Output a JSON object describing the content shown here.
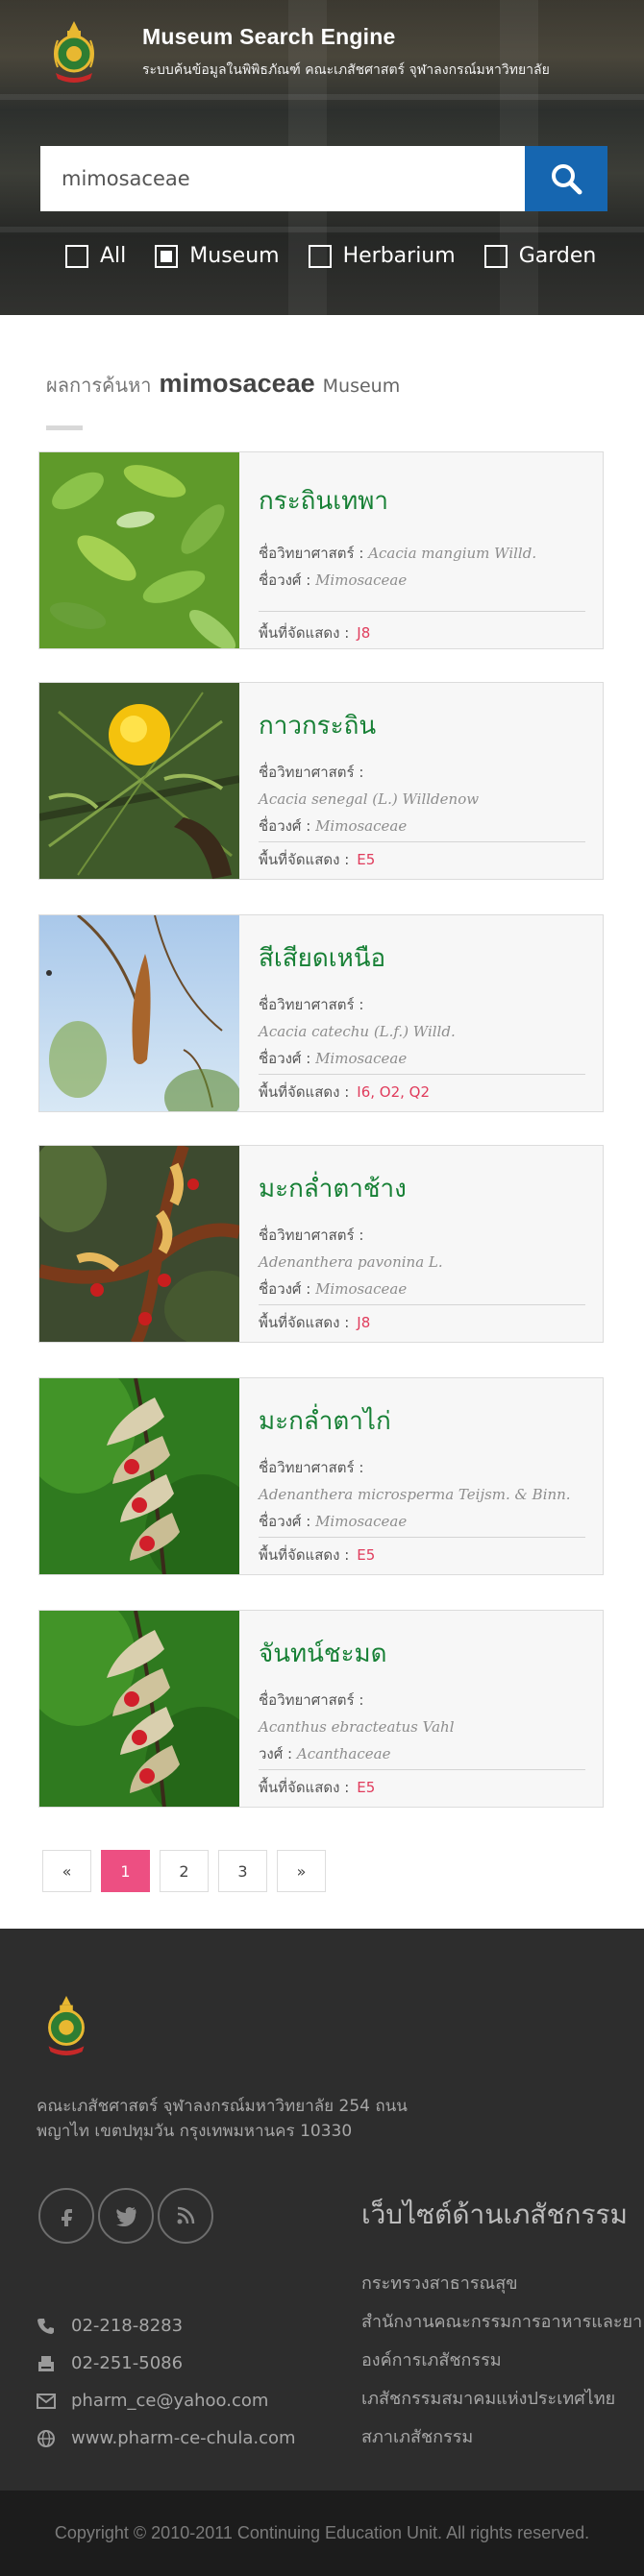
{
  "header": {
    "title": "Museum Search Engine",
    "subtitle": "ระบบค้นข้อมูลในพิพิธภัณฑ์ คณะเภสัชศาสตร์ จุฬาลงกรณ์มหาวิทยาลัย"
  },
  "search": {
    "value": "mimosaceae",
    "placeholder": ""
  },
  "filters": [
    {
      "label": "All",
      "checked": false
    },
    {
      "label": "Museum",
      "checked": true
    },
    {
      "label": "Herbarium",
      "checked": false
    },
    {
      "label": "Garden",
      "checked": false
    }
  ],
  "results": {
    "prefix": "ผลการค้นหา",
    "keyword": "mimosaceae",
    "scope": "Museum"
  },
  "labels": {
    "sci_name": "ชื่อวิทยาศาสตร์",
    "family": "ชื่อวงศ์",
    "family_short": "วงศ์",
    "location": "พื้นที่จัดแสดง :"
  },
  "cards": [
    {
      "name": "กระถินเทพา",
      "sci": "Acacia mangium Willd.",
      "family": "Mimosaceae",
      "loc": "J8",
      "inline_sci": true
    },
    {
      "name": "กาวกระถิน",
      "sci": "Acacia senegal (L.) Willdenow",
      "family": "Mimosaceae",
      "loc": "E5",
      "inline_sci": false
    },
    {
      "name": "สีเสียดเหนือ",
      "sci": "Acacia catechu (L.f.) Willd.",
      "family": "Mimosaceae",
      "loc": "I6, O2, Q2",
      "inline_sci": false
    },
    {
      "name": "มะกล่ำตาช้าง",
      "sci": "Adenanthera pavonina L.",
      "family": "Mimosaceae",
      "loc": "J8",
      "inline_sci": false
    },
    {
      "name": "มะกล่ำตาไก่",
      "sci": "Adenanthera microsperma Teijsm. & Binn.",
      "family": "Mimosaceae",
      "loc": "E5",
      "inline_sci": false
    },
    {
      "name": "จันทน์ชะมด",
      "sci": "Acanthus ebracteatus Vahl",
      "family": "Acanthaceae",
      "loc": "E5",
      "inline_sci": false
    }
  ],
  "pagination": {
    "prev": "«",
    "pages": [
      "1",
      "2",
      "3"
    ],
    "active": "1",
    "next": "»"
  },
  "footer": {
    "address": "คณะเภสัชศาสตร์ จุฬาลงกรณ์มหาวิทยาลัย 254 ถนนพญาไท เขตปทุมวัน กรุงเทพมหานคร 10330",
    "phone": "02-218-8283",
    "fax": "02-251-5086",
    "email": "pharm_ce@yahoo.com",
    "website": "www.pharm-ce-chula.com",
    "links_title": "เว็บไซต์ด้านเภสัชกรรม",
    "links": [
      "กระทรวงสาธารณสุข",
      "สำนักงานคณะกรรมการอาหารและยา",
      "องค์การเภสัชกรรม",
      "เภสัชกรรมสมาคมแห่งประเทศไทย",
      "สภาเภสัชกรรม"
    ],
    "copyright": "Copyright © 2010-2011 Continuing Education Unit. All rights reserved."
  },
  "colors": {
    "search_button": "#1666b0",
    "plant_name": "#178035",
    "location_code": "#e03c5c",
    "active_page": "#ed4f82",
    "footer_bg": "#2d2d2d"
  },
  "icons": [
    "search-icon",
    "facebook-icon",
    "twitter-icon",
    "rss-icon",
    "phone-icon",
    "fax-icon",
    "email-icon",
    "globe-icon"
  ]
}
